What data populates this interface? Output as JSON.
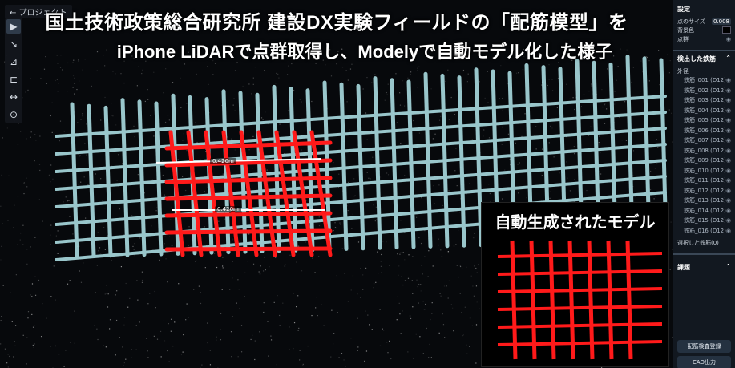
{
  "headline": {
    "line1": "国土技術政策総合研究所 建設DX実験フィールドの「配筋模型」を",
    "line2": "iPhone LiDARで点群取得し、Modelyで自動モデル化した様子"
  },
  "nav": {
    "back_label": "← プロジェクト"
  },
  "toolbar": {
    "icons": [
      "▶",
      "↘",
      "⊿",
      "⊏",
      "↔",
      "⊙"
    ]
  },
  "measurements": {
    "upper": "0.420m",
    "lower": "0.420m"
  },
  "inset": {
    "title": "自動生成されたモデル"
  },
  "panel": {
    "settings_title": "設定",
    "point_size_label": "点のサイズ",
    "point_size_value": "0.008",
    "bg_color_label": "背景色",
    "points_label": "点群",
    "detected_title": "検出した鉄筋",
    "list_header": "外径",
    "rebars": [
      "鉄筋_001 (D12)",
      "鉄筋_002 (D12)",
      "鉄筋_003 (D12)",
      "鉄筋_004 (D12)",
      "鉄筋_005 (D12)",
      "鉄筋_006 (D12)",
      "鉄筋_007 (D12)",
      "鉄筋_008 (D12)",
      "鉄筋_009 (D12)",
      "鉄筋_010 (D12)",
      "鉄筋_011 (D12)",
      "鉄筋_012 (D12)",
      "鉄筋_013 (D12)",
      "鉄筋_014 (D12)",
      "鉄筋_015 (D12)",
      "鉄筋_016 (D12)"
    ],
    "selected_label": "選択した鉄筋(0)",
    "issues_title": "課題",
    "register_button": "配筋検査登録",
    "cad_button": "CAD出力"
  },
  "colors": {
    "rebar_model": "#ff1a1a",
    "rebar_cloud": "#a9dbe0",
    "panel_bg": "#121820"
  }
}
